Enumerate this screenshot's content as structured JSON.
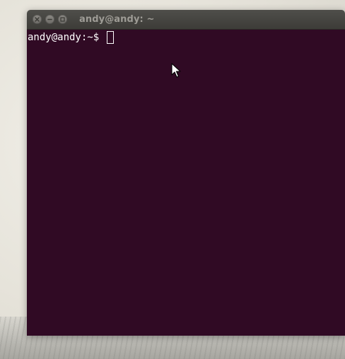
{
  "window": {
    "title": "andy@andy: ~",
    "controls": [
      {
        "name": "close-icon"
      },
      {
        "name": "minimize-icon"
      },
      {
        "name": "maximize-icon"
      }
    ]
  },
  "terminal": {
    "prompt": "andy@andy:~$ ",
    "input_value": "",
    "background_color": "#300a24",
    "text_color": "#ffffff"
  },
  "titlebar": {
    "background_color": "#3d3c38",
    "title_color": "#9e9c96"
  },
  "pointer": {
    "icon": "mouse-pointer-icon"
  }
}
